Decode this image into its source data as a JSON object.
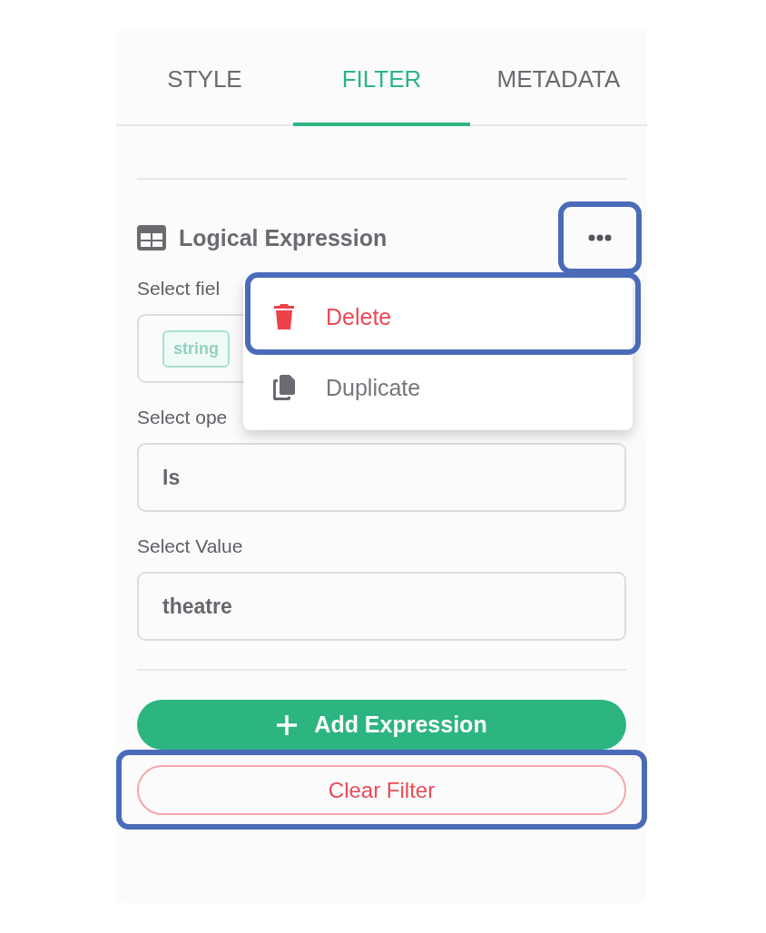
{
  "tabs": [
    {
      "label": "STYLE",
      "selected": false
    },
    {
      "label": "FILTER",
      "selected": true
    },
    {
      "label": "METADATA",
      "selected": false
    }
  ],
  "expression": {
    "title": "Logical Expression",
    "menu_button": {
      "highlighted": true
    },
    "fields": [
      {
        "label": "Select fiel",
        "tag": "string"
      },
      {
        "label": "Select ope",
        "value": "Is"
      },
      {
        "label": "Select Value",
        "value": "theatre"
      }
    ]
  },
  "menu": {
    "items": [
      {
        "kind": "delete",
        "label": "Delete",
        "highlighted": true
      },
      {
        "kind": "duplicate",
        "label": "Duplicate",
        "highlighted": false
      }
    ]
  },
  "add_button": {
    "label": "Add Expression"
  },
  "clear_button": {
    "label": "Clear Filter",
    "highlighted": true
  }
}
